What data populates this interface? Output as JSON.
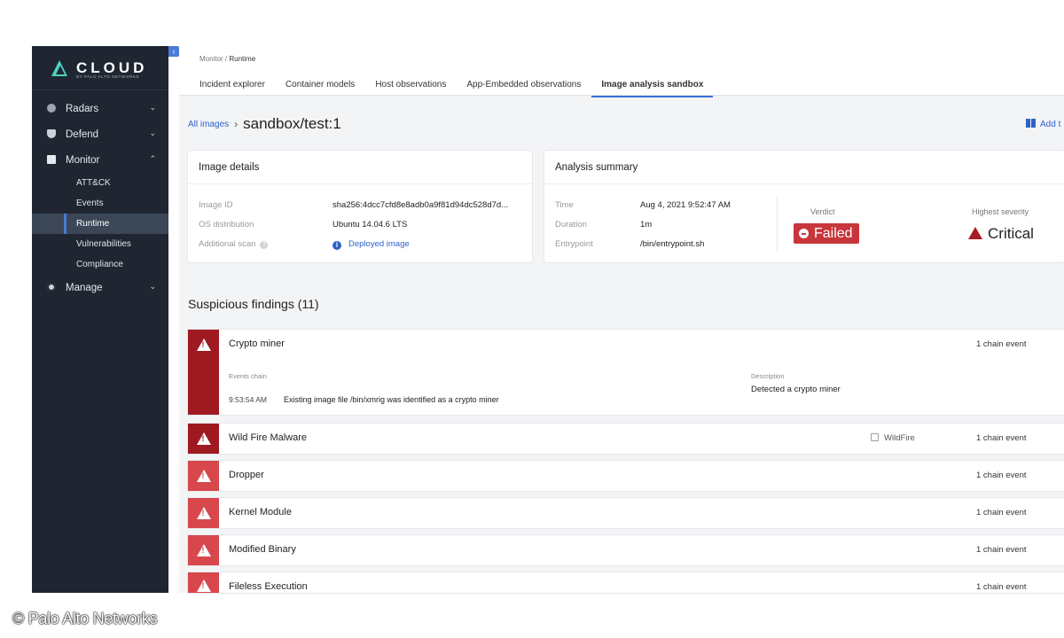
{
  "sidebar": {
    "logo_text": "CLOUD",
    "logo_sub": "BY PALO ALTO NETWORKS",
    "collapse_glyph": "‹",
    "items": [
      {
        "label": "Radars",
        "icon": "radar-icon",
        "chevron": "⌄"
      },
      {
        "label": "Defend",
        "icon": "shield-icon",
        "chevron": "⌄"
      },
      {
        "label": "Monitor",
        "icon": "monitor-icon",
        "chevron": "⌃"
      },
      {
        "label": "Manage",
        "icon": "gear-icon",
        "chevron": "⌄"
      }
    ],
    "monitor_sub": [
      "ATT&CK",
      "Events",
      "Runtime",
      "Vulnerabilities",
      "Compliance"
    ],
    "active_sub": "Runtime"
  },
  "header": {
    "breadcrumb_parent": "Monitor",
    "breadcrumb_sep": " / ",
    "breadcrumb_current": "Runtime",
    "tabs": [
      "Incident explorer",
      "Container models",
      "Host observations",
      "App-Embedded observations",
      "Image analysis sandbox"
    ],
    "active_tab": "Image analysis sandbox"
  },
  "title_row": {
    "all_images": "All images",
    "separator": "›",
    "title": "sandbox/test:1",
    "add_button": "Add t"
  },
  "image_details": {
    "heading": "Image details",
    "image_id_label": "Image ID",
    "image_id_value": "sha256:4dcc7cfd8e8adb0a9f81d94dc528d7d...",
    "os_label": "OS distribution",
    "os_value": "Ubuntu 14.04.6 LTS",
    "scan_label": "Additional scan",
    "scan_help": "?",
    "scan_value": "Deployed image",
    "scan_icon": "i"
  },
  "analysis_summary": {
    "heading": "Analysis summary",
    "time_label": "Time",
    "time_value": "Aug 4, 2021 9:52:47 AM",
    "duration_label": "Duration",
    "duration_value": "1m",
    "entrypoint_label": "Entrypoint",
    "entrypoint_value": "/bin/entrypoint.sh",
    "verdict_label": "Verdict",
    "verdict_value": "Failed",
    "severity_label": "Highest severity",
    "severity_value": "Critical"
  },
  "findings": {
    "title": "Suspicious findings (11)",
    "items": [
      {
        "name": "Crypto miner",
        "count": "1 chain event",
        "severity": "critical",
        "expanded": true
      },
      {
        "name": "Wild Fire Malware",
        "count": "1 chain event",
        "severity": "critical",
        "tag": "WildFire"
      },
      {
        "name": "Dropper",
        "count": "1 chain event",
        "severity": "high"
      },
      {
        "name": "Kernel Module",
        "count": "1 chain event",
        "severity": "high"
      },
      {
        "name": "Modified Binary",
        "count": "1 chain event",
        "severity": "high"
      },
      {
        "name": "Fileless Execution",
        "count": "1 chain event",
        "severity": "high"
      }
    ],
    "expanded": {
      "events_chain_label": "Events chain",
      "event_time": "9:53:54 AM",
      "event_text": "Existing image file /bin/xmrig was identified as a crypto miner",
      "description_label": "Description",
      "description_text": "Detected a crypto miner"
    }
  },
  "colors": {
    "sidebar_bg": "#1f2631",
    "accent": "#2f62c8",
    "critical": "#9e1a20",
    "high": "#d7474c",
    "failed": "#c8353a"
  },
  "watermark": "© Palo Alto Networks"
}
